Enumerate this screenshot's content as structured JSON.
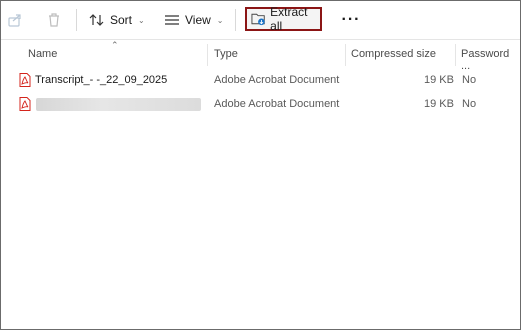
{
  "toolbar": {
    "share_icon": "share-icon",
    "delete_icon": "trash-icon",
    "sort_label": "Sort",
    "view_label": "View",
    "extract_label": "Extract all",
    "more_label": "···"
  },
  "columns": {
    "name": "Name",
    "type": "Type",
    "compressed_size": "Compressed size",
    "password": "Password ..."
  },
  "files": [
    {
      "name": "Transcript_- -_22_09_2025",
      "type": "Adobe Acrobat Document",
      "size": "19 KB",
      "password": "No"
    },
    {
      "name": "",
      "type": "Adobe Acrobat Document",
      "size": "19 KB",
      "password": "No"
    }
  ],
  "colors": {
    "accent": "#8b1515",
    "pdf": "#d4241c",
    "folder_blue": "#1a73c7"
  }
}
